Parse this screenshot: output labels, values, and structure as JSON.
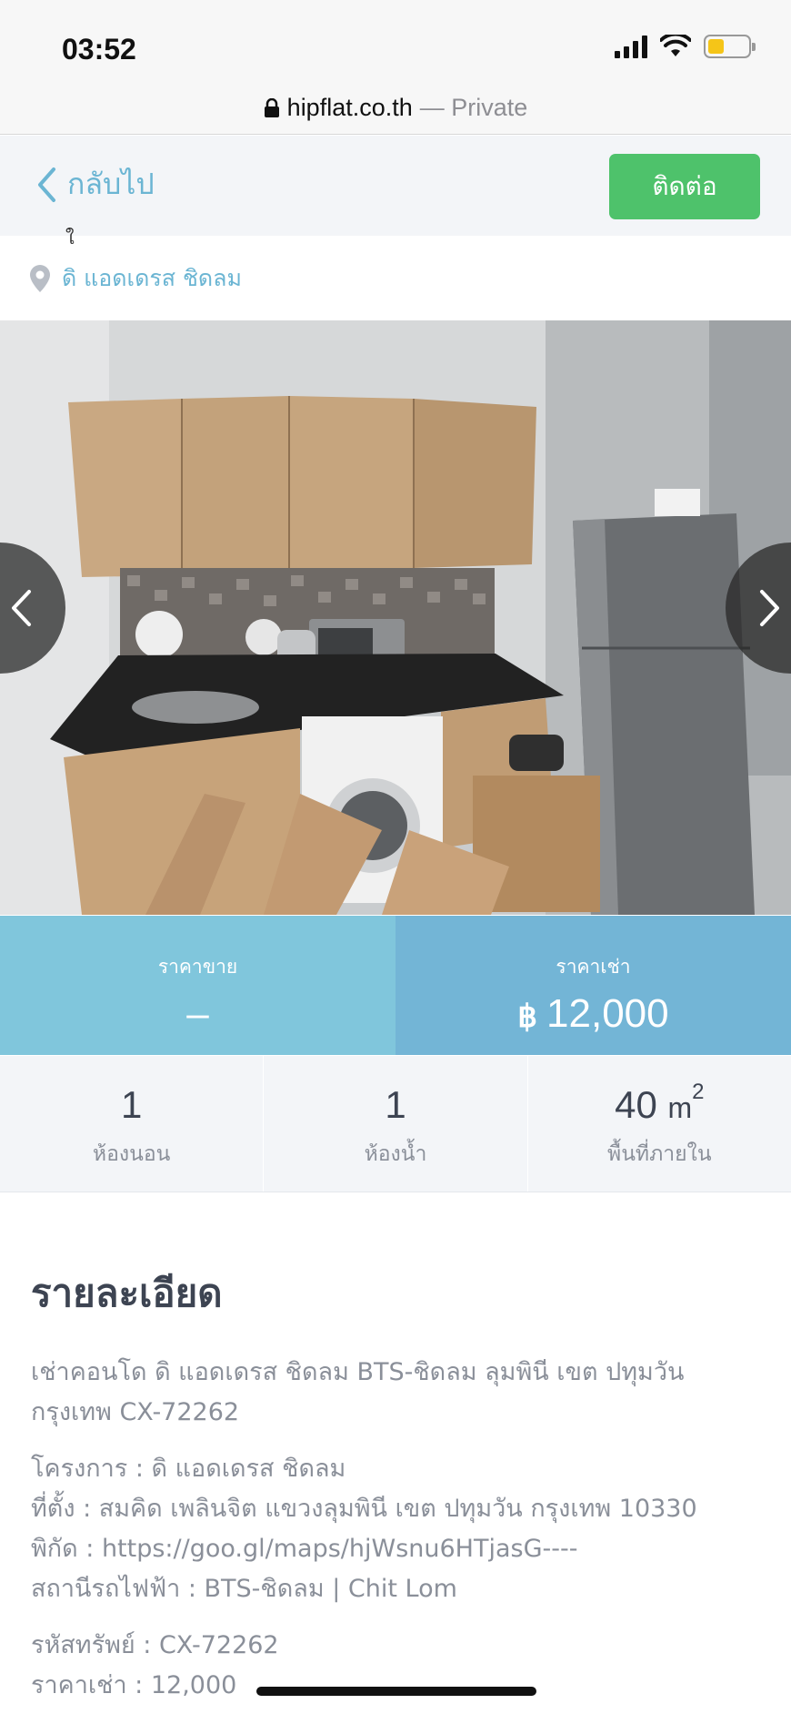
{
  "status_bar": {
    "time": "03:52",
    "battery_color": "#f5c518"
  },
  "address_bar": {
    "domain": "hipflat.co.th",
    "private_label": "— Private"
  },
  "nav": {
    "back_label": "กลับไป",
    "contact_label": "ติดต่อ"
  },
  "listing": {
    "title_partial": "ใ",
    "location": "ดิ แอดเดรส ชิดลม"
  },
  "price": {
    "sale_label": "ราคาขาย",
    "sale_value": "–",
    "rent_label": "ราคาเช่า",
    "currency_symbol": "฿",
    "rent_value": "12,000"
  },
  "stats": {
    "bedrooms_value": "1",
    "bedrooms_label": "ห้องนอน",
    "bathrooms_value": "1",
    "bathrooms_label": "ห้องน้ำ",
    "area_value": "40",
    "area_unit": "m",
    "area_unit_sup": "2",
    "area_label": "พื้นที่ภายใน"
  },
  "details": {
    "heading": "รายละเอียด",
    "summary_line1": "เช่าคอนโด ดิ แอดเดรส ชิดลม BTS-ชิดลม ลุมพินี เขต ปทุมวัน",
    "summary_line2": "กรุงเทพ CX-72262",
    "project": "โครงการ : ดิ แอดเดรส ชิดลม",
    "address": "ที่ตั้ง : สมคิด เพลินจิต แขวงลุมพินี เขต ปทุมวัน กรุงเทพ 10330",
    "coordinates": "พิกัด : https://goo.gl/maps/hjWsnu6HTjasG----",
    "station": "สถานีรถไฟฟ้า : BTS-ชิดลม | Chit Lom",
    "property_code": "รหัสทรัพย์ : CX-72262",
    "rent_price": "ราคาเช่า : 12,000"
  },
  "icons": {
    "lock": "lock-icon",
    "back": "chevron-left-icon",
    "location": "map-pin-icon",
    "gallery_prev": "chevron-left-icon",
    "gallery_next": "chevron-right-icon"
  },
  "colors": {
    "accent_blue": "#6bb5d3",
    "contact_green": "#4ec26b",
    "sale_band": "#80c6dc",
    "rent_band": "#73b5d6"
  }
}
